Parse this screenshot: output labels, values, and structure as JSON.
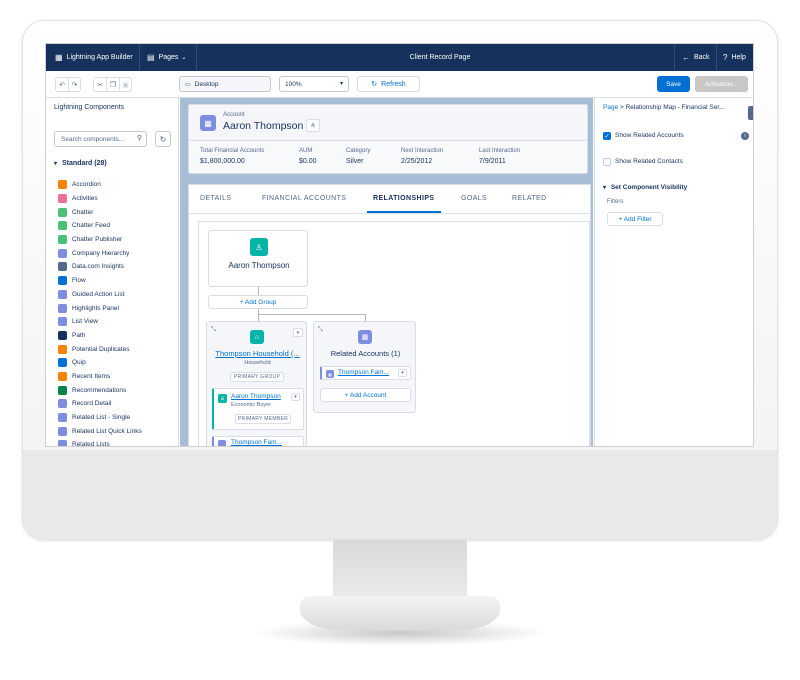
{
  "topbar": {
    "app_label": "Lightning App Builder",
    "pages_label": "Pages",
    "page_title": "Client Record Page",
    "back_label": "Back",
    "help_label": "Help"
  },
  "toolbar": {
    "device_value": "Desktop",
    "zoom_value": "100%",
    "refresh_label": "Refresh",
    "save_label": "Save",
    "activation_label": "Activation..."
  },
  "components": {
    "title": "Lightning Components",
    "search_placeholder": "Search components...",
    "section_label": "Standard (28)",
    "items": [
      {
        "label": "Accordion",
        "color": "#f38303"
      },
      {
        "label": "Activities",
        "color": "#eb7092"
      },
      {
        "label": "Chatter",
        "color": "#4bc076"
      },
      {
        "label": "Chatter Feed",
        "color": "#4bc076"
      },
      {
        "label": "Chatter Publisher",
        "color": "#4bc076"
      },
      {
        "label": "Company Hierarchy",
        "color": "#7f8de1"
      },
      {
        "label": "Data.com Insights",
        "color": "#54698d"
      },
      {
        "label": "Flow",
        "color": "#0070d2"
      },
      {
        "label": "Guided Action List",
        "color": "#7f8de1"
      },
      {
        "label": "Highlights Panel",
        "color": "#7f8de1"
      },
      {
        "label": "List View",
        "color": "#7f8de1"
      },
      {
        "label": "Path",
        "color": "#16325c"
      },
      {
        "label": "Potential Duplicates",
        "color": "#f38303"
      },
      {
        "label": "Quip",
        "color": "#0070d2"
      },
      {
        "label": "Recent Items",
        "color": "#f38303"
      },
      {
        "label": "Recommendations",
        "color": "#04844b"
      },
      {
        "label": "Record Detail",
        "color": "#7f8de1"
      },
      {
        "label": "Related List - Single",
        "color": "#7f8de1"
      },
      {
        "label": "Related List Quick Links",
        "color": "#7f8de1"
      },
      {
        "label": "Related Lists",
        "color": "#7f8de1"
      }
    ]
  },
  "record": {
    "object_label": "Account",
    "name": "Aaron Thompson",
    "fields": [
      {
        "label": "Total Financial Accounts",
        "value": "$1,800,000.00"
      },
      {
        "label": "AUM",
        "value": "$0.00"
      },
      {
        "label": "Category",
        "value": "Silver"
      },
      {
        "label": "Next Interaction",
        "value": "2/25/2012"
      },
      {
        "label": "Last Interaction",
        "value": "7/9/2011"
      }
    ]
  },
  "tabs": [
    "DETAILS",
    "FINANCIAL ACCOUNTS",
    "RELATIONSHIPS",
    "GOALS",
    "RELATED"
  ],
  "relmap": {
    "main_name": "Aaron Thompson",
    "add_group_label": "+ Add Group",
    "household": {
      "name": "Thompson Household (...",
      "type": "Household",
      "badge": "PRIMARY GROUP",
      "member_name": "Aaron Thompson",
      "member_role": "Economic Buyer",
      "member_badge": "PRIMARY MEMBER",
      "second_member": "Thompson Fam..."
    },
    "related": {
      "title": "Related Accounts (1)",
      "item": "Thompson Fam...",
      "add_label": "+ Add Account"
    }
  },
  "properties": {
    "crumb_page": "Page",
    "crumb_current": "Relationship Map - Financial Ser...",
    "show_related_accounts": "Show Related Accounts",
    "show_related_contacts": "Show Related Contacts",
    "visibility_label": "Set Component Visibility",
    "filters_label": "Filters",
    "add_filter_label": "+ Add Filter"
  }
}
